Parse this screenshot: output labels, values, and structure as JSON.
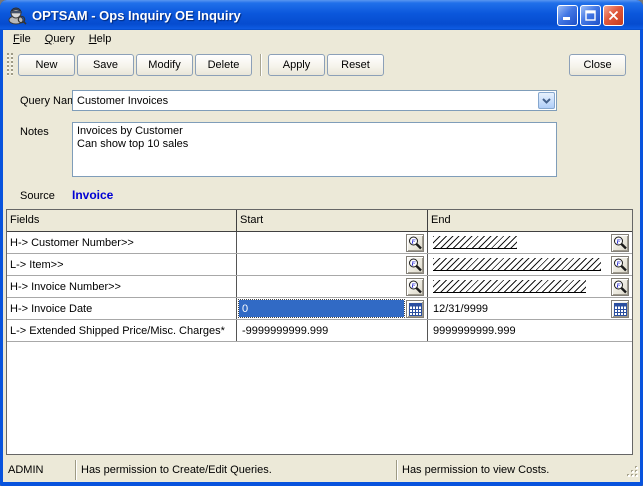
{
  "window": {
    "title": "OPTSAM - Ops Inquiry OE Inquiry"
  },
  "menu": {
    "items": [
      {
        "label": "File"
      },
      {
        "label": "Query"
      },
      {
        "label": "Help"
      }
    ]
  },
  "toolbar": {
    "buttons": [
      "New",
      "Save",
      "Modify",
      "Delete",
      "Apply",
      "Reset",
      "Close"
    ]
  },
  "form": {
    "query_name": {
      "label": "Query Name",
      "value": "Customer Invoices"
    },
    "notes": {
      "label": "Notes",
      "value": "Invoices by Customer\nCan show top 10 sales"
    },
    "source": {
      "label": "Source",
      "value": "Invoice",
      "color": "#0000D4"
    }
  },
  "table": {
    "headers": [
      "Fields",
      "Start",
      "End"
    ],
    "rows": [
      {
        "field": "H-> Customer Number>>",
        "start_value": "",
        "start_control": "lookup",
        "end_control": "lookup",
        "end_mask_width": 84
      },
      {
        "field": "L-> Item>>",
        "start_value": "",
        "start_control": "lookup",
        "end_control": "lookup",
        "end_mask_width": 168
      },
      {
        "field": "H-> Invoice Number>>",
        "start_value": "",
        "start_control": "lookup",
        "end_control": "lookup",
        "end_mask_width": 153
      },
      {
        "field": "H-> Invoice Date",
        "start_value": "0",
        "start_selected": true,
        "start_control": "calendar",
        "end_value": "12/31/9999",
        "end_control": "calendar"
      },
      {
        "field": "L-> Extended Shipped Price/Misc. Charges*",
        "start_value": "-9999999999.999",
        "end_value": "9999999999.999"
      }
    ]
  },
  "statusbar": {
    "user": "ADMIN",
    "permissions": [
      "Has permission to Create/Edit Queries.",
      "Has permission to view Costs."
    ]
  },
  "colors": {
    "titlebar": "#0853DD",
    "window_bg": "#ECE9D8",
    "selection": "#316AC5",
    "source_text": "#0000D4"
  }
}
